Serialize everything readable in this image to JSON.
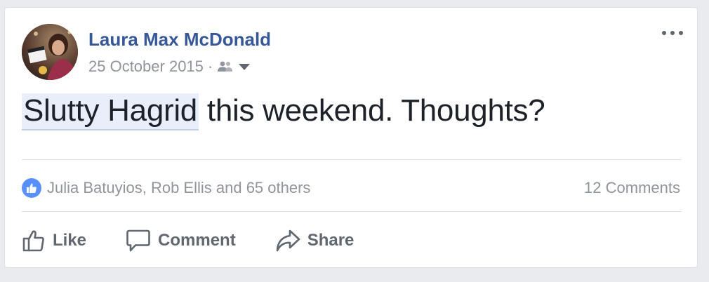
{
  "post": {
    "author": "Laura Max McDonald",
    "date": "25 October 2015",
    "separator": "·",
    "privacy_icon": "friends-icon",
    "more_icon": "more-options-icon",
    "text_tag": "Slutty Hagrid",
    "text_rest": " this weekend. Thoughts?"
  },
  "stats": {
    "reaction_icon": "like-reaction-icon",
    "reactions_text": "Julia Batuyios, Rob Ellis and 65 others",
    "comments_text": "12 Comments"
  },
  "actions": {
    "like_label": "Like",
    "comment_label": "Comment",
    "share_label": "Share"
  },
  "colors": {
    "author": "#365899",
    "meta": "#90949c",
    "text": "#1d2129",
    "like_badge": "#5890ff",
    "tag_highlight": "#e9effa",
    "action": "#606770"
  }
}
